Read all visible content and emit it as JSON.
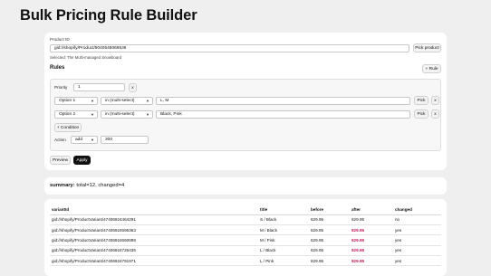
{
  "page": {
    "title": "Bulk Pricing Rule Builder"
  },
  "product": {
    "label": "Product ID",
    "value": "gid://shopify/Product/9040548069536",
    "pick_label": "Pick product",
    "selected_text": "Selected: The Multi-managed Snowboard"
  },
  "rules": {
    "title": "Rules",
    "add_rule_label": "+ Rule",
    "priority_label": "Priority",
    "priority_value": "1",
    "remove_label": "x",
    "conditions": [
      {
        "option": "Option 1",
        "operator": "in (multi-select)",
        "values": "L, M",
        "pick_label": "Pick",
        "remove_label": "x"
      },
      {
        "option": "Option 2",
        "operator": "in (multi-select)",
        "values": "Black, Pink",
        "pick_label": "Pick",
        "remove_label": "x"
      }
    ],
    "add_condition_label": "+ Condition",
    "action_label": "Action",
    "action_type": "add",
    "action_value": "300"
  },
  "buttons": {
    "preview_label": "Preview",
    "apply_label": "Apply"
  },
  "summary": {
    "label": "summary:",
    "text": " total=12, changed=4"
  },
  "table": {
    "headers": [
      "variantId",
      "title",
      "before",
      "after",
      "changed"
    ],
    "rows": [
      {
        "variantId": "gid://shopify/ProductVariant/47406924464291",
        "title": "S / Black",
        "before": "629.95",
        "after": "629.95",
        "changed": "no",
        "is_changed": false
      },
      {
        "variantId": "gid://shopify/ProductVariant/47406924595363",
        "title": "M / Black",
        "before": "629.95",
        "after": "929.95",
        "changed": "yes",
        "is_changed": true
      },
      {
        "variantId": "gid://shopify/ProductVariant/47406924660899",
        "title": "M / Pink",
        "before": "629.95",
        "after": "929.95",
        "changed": "yes",
        "is_changed": true
      },
      {
        "variantId": "gid://shopify/ProductVariant/47406924726435",
        "title": "L / Black",
        "before": "629.95",
        "after": "929.95",
        "changed": "yes",
        "is_changed": true
      },
      {
        "variantId": "gid://shopify/ProductVariant/47406924791971",
        "title": "L / Pink",
        "before": "629.95",
        "after": "929.95",
        "changed": "yes",
        "is_changed": true
      }
    ]
  },
  "colors": {
    "changed_after": "#c2185b",
    "primary_button": "#111111"
  }
}
